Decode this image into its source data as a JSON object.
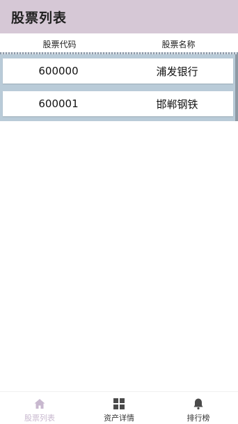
{
  "app_bar": {
    "title": "股票列表"
  },
  "table": {
    "headers": [
      "股票代码",
      "股票名称"
    ],
    "rows": [
      {
        "code": "600000",
        "name": "浦发银行"
      },
      {
        "code": "600001",
        "name": "邯郸钢铁"
      }
    ]
  },
  "bottom_nav": {
    "items": [
      {
        "label": "股票列表",
        "icon": "home-icon",
        "active": true
      },
      {
        "label": "资产详情",
        "icon": "grid-icon",
        "active": false
      },
      {
        "label": "排行榜",
        "icon": "bell-icon",
        "active": false
      }
    ]
  },
  "colors": {
    "app_bar": "#d6c8d6",
    "list_bg": "#b9cbd8",
    "active_nav": "#c8b8cf"
  }
}
